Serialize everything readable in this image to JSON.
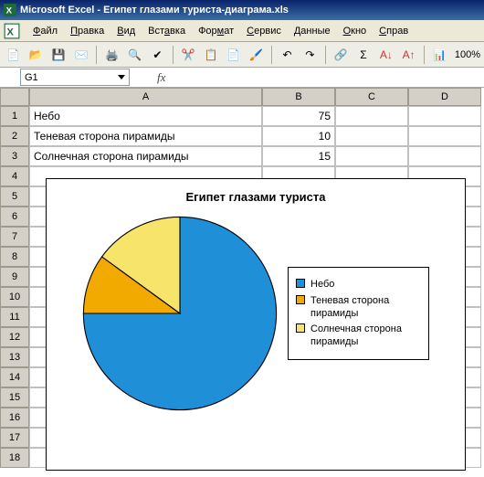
{
  "title": "Microsoft Excel - Египет глазами туриста-диаграма.xls",
  "menu": {
    "file": "Файл",
    "edit": "Правка",
    "view": "Вид",
    "insert": "Вставка",
    "format": "Формат",
    "tools": "Сервис",
    "data": "Данные",
    "window": "Окно",
    "help": "Справ"
  },
  "zoom": "100%",
  "namebox": "G1",
  "fx_label": "fx",
  "columns": [
    "A",
    "B",
    "C",
    "D"
  ],
  "rows": [
    "1",
    "2",
    "3",
    "4",
    "5",
    "6",
    "7",
    "8",
    "9",
    "10",
    "11",
    "12",
    "13",
    "14",
    "15",
    "16",
    "17",
    "18"
  ],
  "cells": {
    "A1": "Небо",
    "A2": "Теневая сторона пирамиды",
    "A3": "Солнечная сторона пирамиды",
    "B1": "75",
    "B2": "10",
    "B3": "15"
  },
  "chart_data": {
    "type": "pie",
    "title": "Египет глазами туриста",
    "series": [
      {
        "name": "Небо",
        "value": 75,
        "color": "#1f8fd8"
      },
      {
        "name": "Теневая сторона пирамиды",
        "value": 10,
        "color": "#f2a900"
      },
      {
        "name": "Солнечная сторона пирамиды",
        "value": 15,
        "color": "#f7e46b"
      }
    ]
  }
}
